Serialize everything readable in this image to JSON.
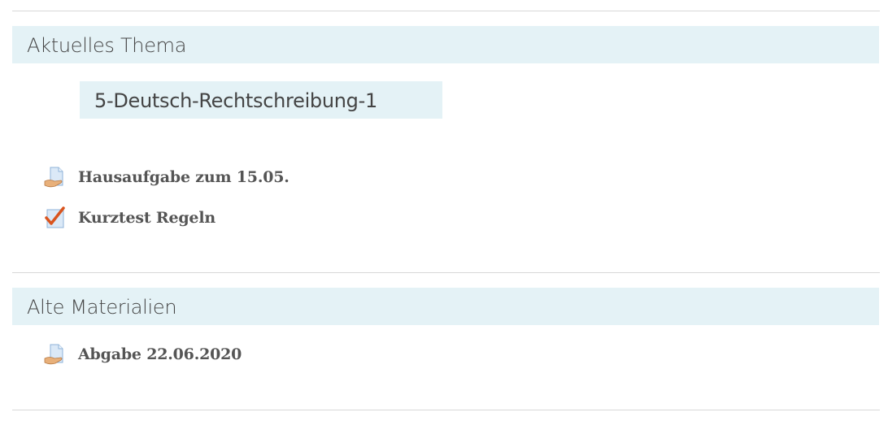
{
  "sections": [
    {
      "title": "Aktuelles Thema",
      "label": "5-Deutsch-Rechtschreibung-1",
      "activities": [
        {
          "name": "Hausaufgabe zum 15.05.",
          "icon": "assignment-icon"
        },
        {
          "name": "Kurztest Regeln",
          "icon": "quiz-icon"
        }
      ]
    },
    {
      "title": "Alte Materialien",
      "activities": [
        {
          "name": "Abgabe 22.06.2020",
          "icon": "assignment-icon"
        }
      ]
    }
  ],
  "colors": {
    "section_bg": "#e4f2f6",
    "divider": "#d8d8d8",
    "text": "#555555"
  }
}
